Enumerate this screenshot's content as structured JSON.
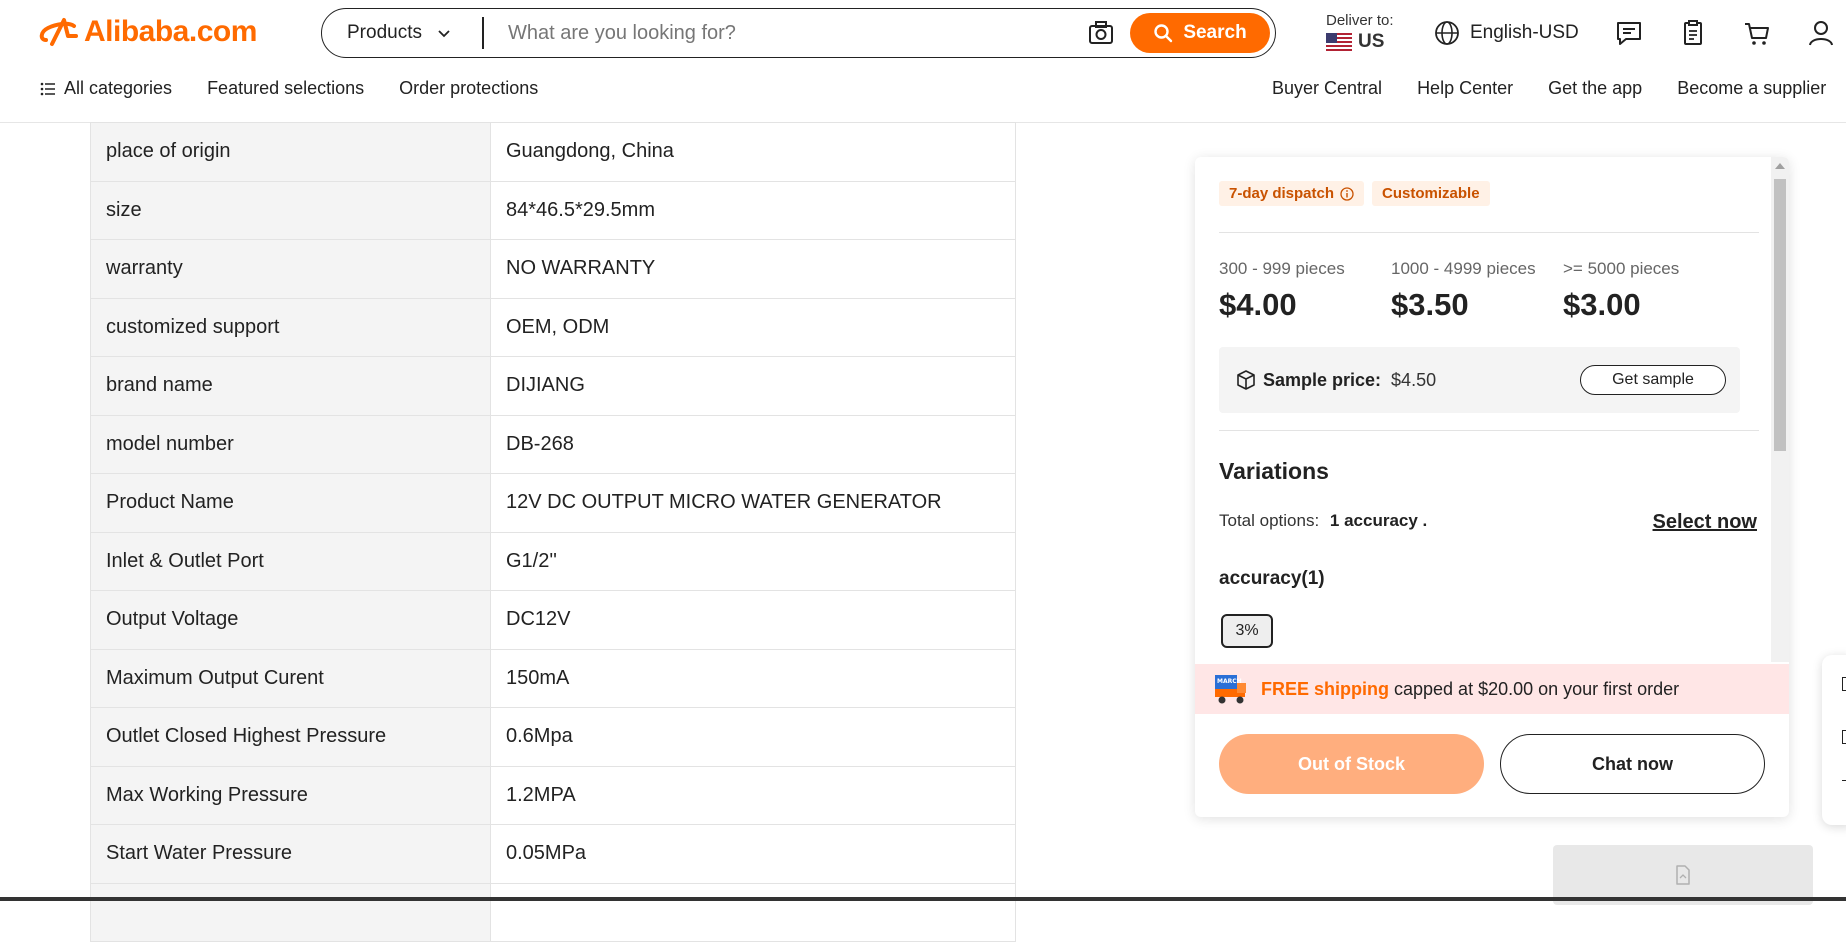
{
  "header": {
    "logo_text": "Alibaba.com",
    "search": {
      "category": "Products",
      "placeholder": "What are you looking for?",
      "button_label": "Search"
    },
    "deliver_to_label": "Deliver to:",
    "deliver_country": "US",
    "language": "English-USD"
  },
  "nav": {
    "left": [
      "All categories",
      "Featured selections",
      "Order protections"
    ],
    "right": [
      "Buyer Central",
      "Help Center",
      "Get the app",
      "Become a supplier"
    ]
  },
  "specs": [
    {
      "key": "place of origin",
      "value": "Guangdong, China"
    },
    {
      "key": "size",
      "value": "84*46.5*29.5mm"
    },
    {
      "key": "warranty",
      "value": "NO WARRANTY"
    },
    {
      "key": "customized support",
      "value": "OEM, ODM"
    },
    {
      "key": "brand name",
      "value": "DIJIANG"
    },
    {
      "key": "model number",
      "value": "DB-268"
    },
    {
      "key": "Product Name",
      "value": "12V DC OUTPUT MICRO WATER GENERATOR"
    },
    {
      "key": "Inlet & Outlet Port",
      "value": "G1/2''"
    },
    {
      "key": "Output Voltage",
      "value": "DC12V"
    },
    {
      "key": "Maximum Output Curent",
      "value": "150mA"
    },
    {
      "key": "Outlet Closed Highest Pressure",
      "value": "0.6Mpa"
    },
    {
      "key": "Max Working Pressure",
      "value": "1.2MPA"
    },
    {
      "key": "Start Water Pressure",
      "value": "0.05MPa"
    }
  ],
  "card": {
    "badges": [
      "7-day dispatch",
      "Customizable"
    ],
    "tiers": [
      {
        "qty": "300 - 999 pieces",
        "price": "$4.00"
      },
      {
        "qty": "1000 - 4999 pieces",
        "price": "$3.50"
      },
      {
        "qty": ">= 5000 pieces",
        "price": "$3.00"
      }
    ],
    "sample_label": "Sample price:",
    "sample_price": "$4.50",
    "get_sample": "Get sample",
    "variations_title": "Variations",
    "total_options_label": "Total options:",
    "total_options_value": "1 accuracy .",
    "select_now": "Select now",
    "accuracy_title": "accuracy(1)",
    "accuracy_option": "3%",
    "promo_free": "FREE shipping",
    "promo_rest": "capped at $20.00 on your first order",
    "promo_truck_label": "MARCH",
    "out_of_stock": "Out of Stock",
    "chat_now": "Chat now"
  },
  "colors": {
    "brand": "#ff6a00",
    "disabled_button": "#ffae7e",
    "promo_bg": "#ffe6e6"
  }
}
